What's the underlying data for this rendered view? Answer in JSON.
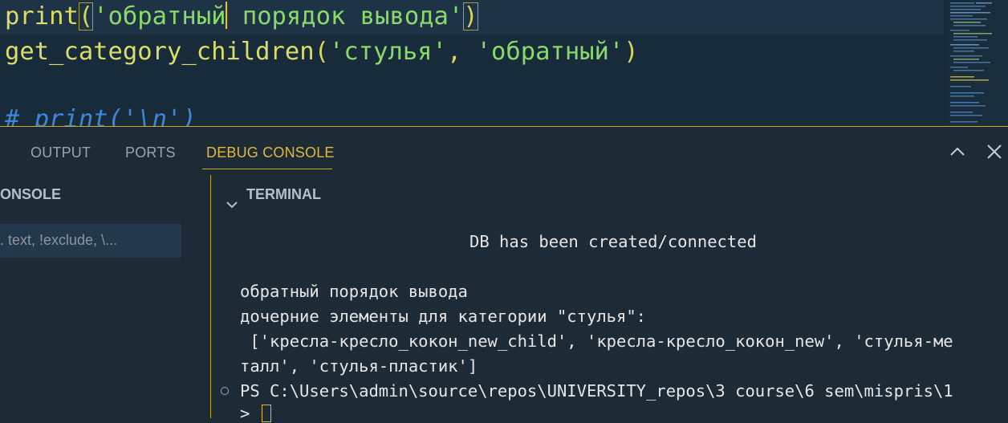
{
  "editor": {
    "line1": {
      "fn": "print",
      "open": "(",
      "str_a": "'обратный",
      "str_b": " порядок вывода'",
      "close": ")"
    },
    "line2": {
      "fn": "get_category_children",
      "open": "(",
      "arg1": "'стулья'",
      "sep": ", ",
      "arg2": "'обратный'",
      "close": ")"
    },
    "line4": {
      "comment": "# print('\\n')"
    }
  },
  "panel": {
    "tabs": [
      {
        "label": "OUTPUT"
      },
      {
        "label": "PORTS"
      },
      {
        "label": "DEBUG CONSOLE"
      }
    ],
    "active_tab": "DEBUG CONSOLE",
    "accent_color": "#d2a81a",
    "console_header": "ONSOLE",
    "filter_placeholder": ". text, !exclude, \\...",
    "terminal_header": "TERMINAL",
    "terminal_lines": [
      "DB has been created/connected",
      "обратный порядок вывода",
      "дочерние элементы для категории \"стулья\":",
      " ['кресла-кресло_кокон_new_child', 'кресла-кресло_кокон_new', 'стулья-ме",
      "талл', 'стулья-пластик']",
      "PS C:\\Users\\admin\\source\\repos\\UNIVERSITY_repos\\3 course\\6 sem\\mispris\\1",
      ">"
    ]
  }
}
